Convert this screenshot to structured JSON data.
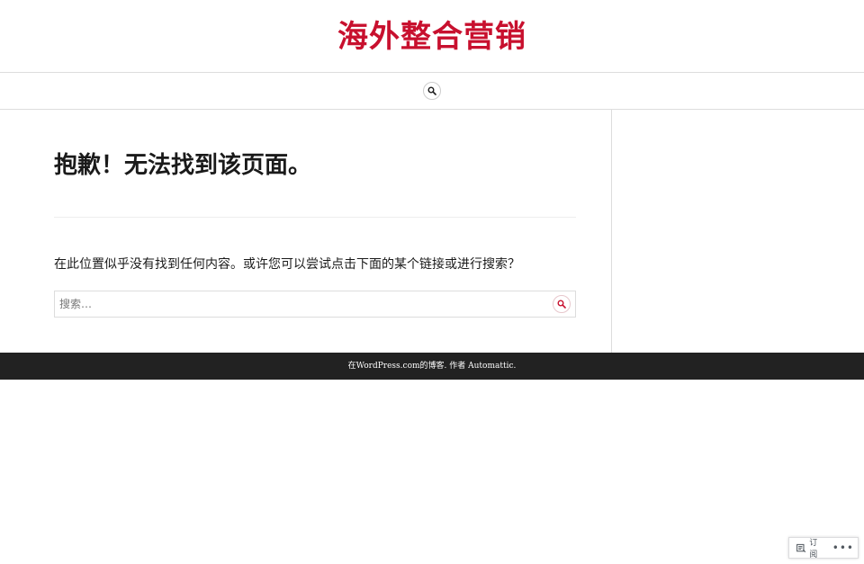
{
  "header": {
    "site_title": "海外整合营销",
    "title_color": "#c8102e"
  },
  "nav": {
    "search_toggle_icon": "search-icon"
  },
  "main": {
    "page_title": "抱歉！无法找到该页面。",
    "message": "在此位置似乎没有找到任何内容。或许您可以尝试点击下面的某个链接或进行搜索？",
    "search": {
      "placeholder": "搜索…",
      "value": "",
      "submit_icon": "search-icon"
    }
  },
  "footer": {
    "blog_link": "在WordPress.com的博客.",
    "author_prefix": " 作者 ",
    "author_link": "Automattic.",
    "background": "#222222"
  },
  "action_bar": {
    "subscribe_label": "订阅",
    "subscribe_icon": "reader-icon",
    "more_label": "•••"
  }
}
